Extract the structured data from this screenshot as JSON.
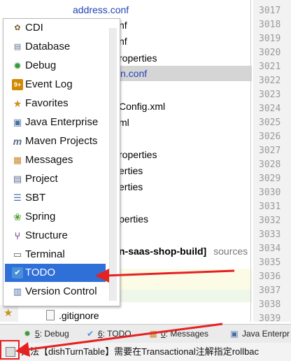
{
  "tree": {
    "rows": [
      {
        "text": "address.conf",
        "style": "blue"
      },
      {
        "text": "nf",
        "style": ""
      },
      {
        "text": "nf",
        "style": ""
      },
      {
        "text": "roperties",
        "style": ""
      },
      {
        "text": "n.conf",
        "style": "blue-selected"
      },
      {
        "text": "Config.xml",
        "style": ""
      },
      {
        "text": "ml",
        "style": ""
      },
      {
        "text": "roperties",
        "style": ""
      },
      {
        "text": "erties",
        "style": ""
      },
      {
        "text": "erties",
        "style": ""
      },
      {
        "text": "perties",
        "style": ""
      },
      {
        "text": "n-saas-shop-build]",
        "suffix": "sources",
        "style": "bold"
      },
      {
        "text": ".gitignore",
        "style": ""
      }
    ]
  },
  "gutter": {
    "line_numbers": [
      "3017",
      "3018",
      "3019",
      "3020",
      "3021",
      "3022",
      "3023",
      "3024",
      "3025",
      "3026",
      "3027",
      "3028",
      "3029",
      "3030",
      "3031",
      "3032",
      "3033",
      "3034",
      "3035",
      "3036",
      "3037",
      "3038",
      "3039"
    ]
  },
  "popup": {
    "items": [
      {
        "label": "CDI",
        "icon": "cdi-icon",
        "glyph": "✿",
        "color": "#7a5b2a"
      },
      {
        "label": "Database",
        "icon": "database-icon",
        "glyph": "▤",
        "color": "#5a6d8c"
      },
      {
        "label": "Debug",
        "icon": "bug-icon",
        "glyph": "✹",
        "color": "#3a9a3a"
      },
      {
        "label": "Event Log",
        "icon": "event-log-icon",
        "glyph": "9+",
        "color": "#d08a00"
      },
      {
        "label": "Favorites",
        "icon": "star-icon",
        "glyph": "★",
        "color": "#c8921e"
      },
      {
        "label": "Java Enterprise",
        "icon": "java-enterprise-icon",
        "glyph": "▣",
        "color": "#4a6fa5"
      },
      {
        "label": "Maven Projects",
        "icon": "maven-icon",
        "glyph": "m",
        "color": "#5a6b84"
      },
      {
        "label": "Messages",
        "icon": "messages-icon",
        "glyph": "▦",
        "color": "#c9882a"
      },
      {
        "label": "Project",
        "icon": "project-icon",
        "glyph": "▤",
        "color": "#5b6c8a"
      },
      {
        "label": "SBT",
        "icon": "sbt-icon",
        "glyph": "☰",
        "color": "#4a6fa5"
      },
      {
        "label": "Spring",
        "icon": "spring-icon",
        "glyph": "❀",
        "color": "#5aa13a"
      },
      {
        "label": "Structure",
        "icon": "structure-icon",
        "glyph": "⑂",
        "color": "#7a4a9a"
      },
      {
        "label": "Terminal",
        "icon": "terminal-icon",
        "glyph": "▭",
        "color": "#555555"
      },
      {
        "label": "TODO",
        "icon": "todo-icon",
        "glyph": "✔",
        "color": "#4a90d9",
        "active": true
      },
      {
        "label": "Version Control",
        "icon": "version-control-icon",
        "glyph": "▥",
        "color": "#4a6fa5"
      }
    ]
  },
  "toolbar": {
    "buttons": [
      {
        "num": "5",
        "label": ": Debug",
        "icon": "bug-icon",
        "glyph": "✹"
      },
      {
        "num": "6",
        "label": ": TODO",
        "icon": "todo-icon",
        "glyph": "✔"
      },
      {
        "num": "0",
        "label": ": Messages",
        "icon": "messages-icon",
        "glyph": "▦"
      },
      {
        "num": "",
        "label": "Java Enterpr",
        "icon": "java-enterprise-icon",
        "glyph": "▣"
      }
    ]
  },
  "status": {
    "text": "方法【dishTurnTable】需要在Transactional注解指定rollbac"
  },
  "colors": {
    "accent": "#2f6fd8",
    "annotation_red": "#e52222"
  }
}
